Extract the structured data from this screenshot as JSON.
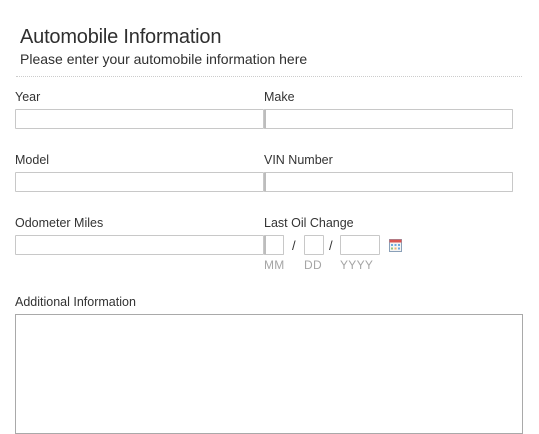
{
  "header": {
    "title": "Automobile Information",
    "subtitle": "Please enter your automobile information here"
  },
  "fields": {
    "year_label": "Year",
    "make_label": "Make",
    "model_label": "Model",
    "vin_label": "VIN Number",
    "odometer_label": "Odometer Miles",
    "oil_change_label": "Last Oil Change",
    "date_sep": "/",
    "date_mm": "MM",
    "date_dd": "DD",
    "date_yyyy": "YYYY",
    "additional_label": "Additional Information"
  },
  "icons": {
    "calendar": "calendar-icon"
  }
}
